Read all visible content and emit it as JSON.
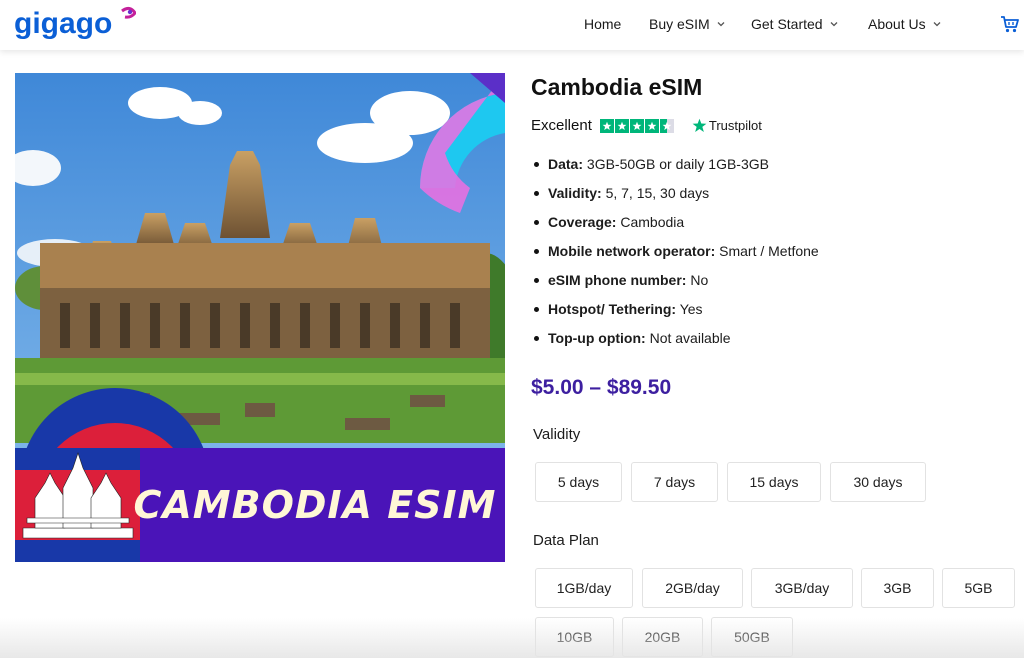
{
  "brand": {
    "logo_text": "gigago",
    "primary_color": "#0b5fd6",
    "accent_color": "#c4209a"
  },
  "nav": {
    "items": [
      {
        "label": "Home",
        "has_dropdown": false
      },
      {
        "label": "Buy eSIM",
        "has_dropdown": true
      },
      {
        "label": "Get Started",
        "has_dropdown": true
      },
      {
        "label": "About Us",
        "has_dropdown": true
      }
    ],
    "cart_icon": "cart-icon"
  },
  "product": {
    "image_banner_text": "CAMBODIA ESIM",
    "title": "Cambodia eSIM",
    "rating": {
      "label": "Excellent",
      "stars": 4.5,
      "provider": "Trustpilot",
      "star_color": "#00b67a"
    },
    "specs": [
      {
        "key": "Data:",
        "value": " 3GB-50GB or daily 1GB-3GB"
      },
      {
        "key": "Validity:",
        "value": " 5, 7, 15, 30 days"
      },
      {
        "key": "Coverage:",
        "value": " Cambodia"
      },
      {
        "key": "Mobile network operator:",
        "value": " Smart / Metfone"
      },
      {
        "key": "eSIM phone number:",
        "value": " No"
      },
      {
        "key": "Hotspot/ Tethering:",
        "value": " Yes"
      },
      {
        "key": "Top-up option:",
        "value": " Not available"
      }
    ],
    "price": "$5.00 – $89.50",
    "price_color": "#3d1fa0",
    "validity": {
      "label": "Validity",
      "options": [
        "5 days",
        "7 days",
        "15 days",
        "30 days"
      ]
    },
    "data_plan": {
      "label": "Data Plan",
      "options": [
        "1GB/day",
        "2GB/day",
        "3GB/day",
        "3GB",
        "5GB",
        "10GB",
        "20GB",
        "50GB"
      ]
    }
  }
}
